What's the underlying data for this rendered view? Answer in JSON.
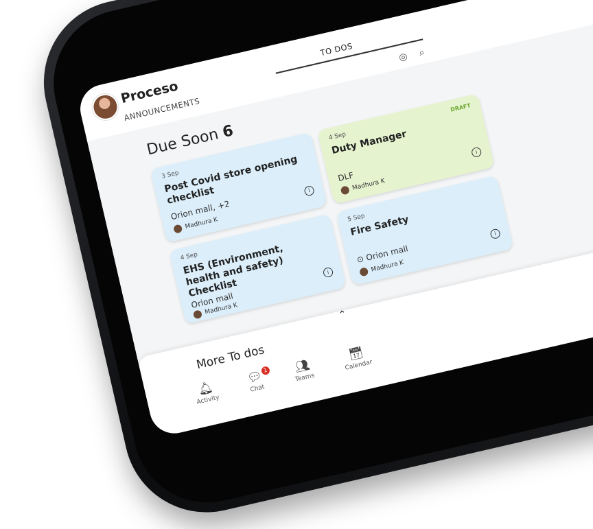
{
  "app": {
    "title": "Proceso"
  },
  "tabs": [
    {
      "label": "ANNOUNCEMENTS"
    },
    {
      "label": "TO DOS"
    }
  ],
  "due_soon": {
    "label": "Due Soon",
    "count": "6"
  },
  "cards": [
    {
      "date": "3 Sep",
      "title": "Post Covid store opening checklist",
      "location": "Orion mall, +2",
      "assignee": "Madhura K",
      "color": "#dbeefa",
      "draft": ""
    },
    {
      "date": "4 Sep",
      "title": "Duty Manager",
      "location": "DLF",
      "assignee": "Madhura K",
      "color": "#e6f3cf",
      "draft": "DRAFT"
    },
    {
      "date": "4 Sep",
      "title": "EHS (Environment, health and safety) Checklist",
      "location": "Orion mall",
      "assignee": "Madhura K",
      "color": "#dbeefa",
      "draft": ""
    },
    {
      "date": "5 Sep",
      "title": "Fire Safety",
      "location": "Orion mall",
      "assignee": "Madhura K",
      "color": "#dbeefa",
      "draft": ""
    }
  ],
  "more": {
    "label": "More To dos"
  },
  "nav": [
    {
      "label": "Activity",
      "icon": "bell-icon"
    },
    {
      "label": "Chat",
      "icon": "chat-icon",
      "badge": "1"
    },
    {
      "label": "Teams",
      "icon": "teams-icon"
    },
    {
      "label": "Calendar",
      "icon": "calendar-icon"
    }
  ],
  "colors": {
    "accent": "#6aa82f",
    "badge": "#d93025"
  }
}
